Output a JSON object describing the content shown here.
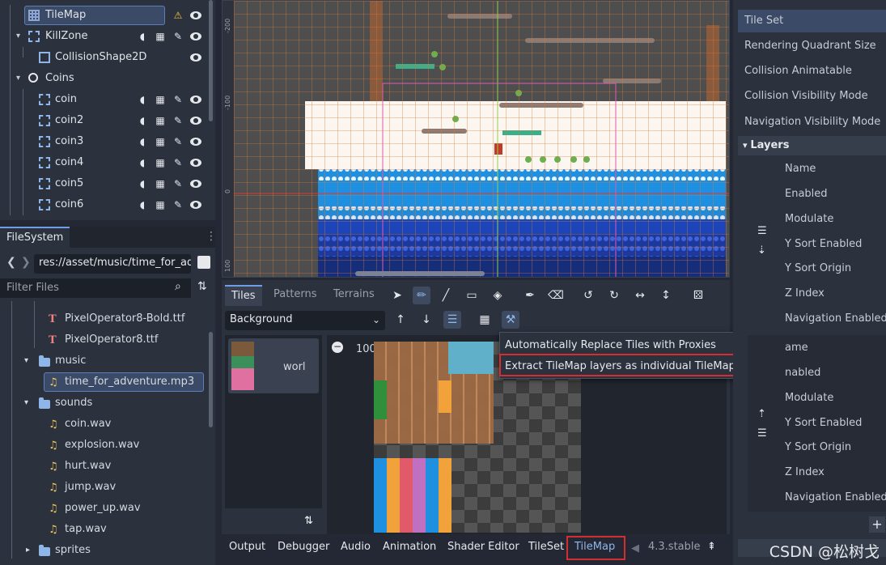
{
  "scene_tree": {
    "nodes": [
      {
        "label": "TileMap",
        "has_warning": true
      },
      {
        "label": "KillZone"
      },
      {
        "label": "CollisionShape2D"
      },
      {
        "label": "Coins"
      },
      {
        "label": "coin"
      },
      {
        "label": "coin2"
      },
      {
        "label": "coin3"
      },
      {
        "label": "coin4"
      },
      {
        "label": "coin5"
      },
      {
        "label": "coin6"
      }
    ]
  },
  "filesystem": {
    "tab_label": "FileSystem",
    "path": "res://asset/music/time_for_ad",
    "filter_placeholder": "Filter Files",
    "items": [
      {
        "label": "PixelOperator8-Bold.ttf",
        "kind": "font"
      },
      {
        "label": "PixelOperator8.ttf",
        "kind": "font"
      },
      {
        "label": "music",
        "kind": "folder"
      },
      {
        "label": "time_for_adventure.mp3",
        "kind": "audio",
        "selected": true
      },
      {
        "label": "sounds",
        "kind": "folder"
      },
      {
        "label": "coin.wav",
        "kind": "audio"
      },
      {
        "label": "explosion.wav",
        "kind": "audio"
      },
      {
        "label": "hurt.wav",
        "kind": "audio"
      },
      {
        "label": "jump.wav",
        "kind": "audio"
      },
      {
        "label": "power_up.wav",
        "kind": "audio"
      },
      {
        "label": "tap.wav",
        "kind": "audio"
      },
      {
        "label": "sprites",
        "kind": "folder"
      }
    ]
  },
  "viewport": {
    "ruler_labels": [
      "-200",
      "-100",
      "0",
      "100"
    ]
  },
  "tile_panel": {
    "tabs": [
      "Tiles",
      "Patterns",
      "Terrains"
    ],
    "active_tab": "Tiles",
    "layer_select": "Background",
    "tileset_item_label": "worl",
    "zoom_label": "100",
    "menu": {
      "items": [
        "Automatically Replace Tiles with Proxies",
        "Extract TileMap layers as individual TileMapLayer nodes"
      ]
    }
  },
  "bottom_bar": {
    "items": [
      "Output",
      "Debugger",
      "Audio",
      "Animation",
      "Shader Editor",
      "TileSet",
      "TileMap"
    ],
    "active": "TileMap",
    "version": "4.3.stable"
  },
  "inspector": {
    "top_rows": [
      "Tile Set",
      "Rendering Quadrant Size",
      "Collision Animatable",
      "Collision Visibility Mode",
      "Navigation Visibility Mode"
    ],
    "layers_section": "Layers",
    "layer_props_1": [
      "Name",
      "Enabled",
      "Modulate",
      "Y Sort Enabled",
      "Y Sort Origin",
      "Z Index",
      "Navigation Enabled"
    ],
    "layer_props_2": [
      "ame",
      "nabled",
      "Modulate",
      "Y Sort Enabled",
      "Y Sort Origin",
      "Z Index",
      "Navigation Enabled"
    ]
  },
  "watermark": "CSDN @松树戈",
  "colors": {
    "accent": "#6f9ee6",
    "highlight_red": "#d62e2e",
    "water": "#1f8fe0"
  }
}
